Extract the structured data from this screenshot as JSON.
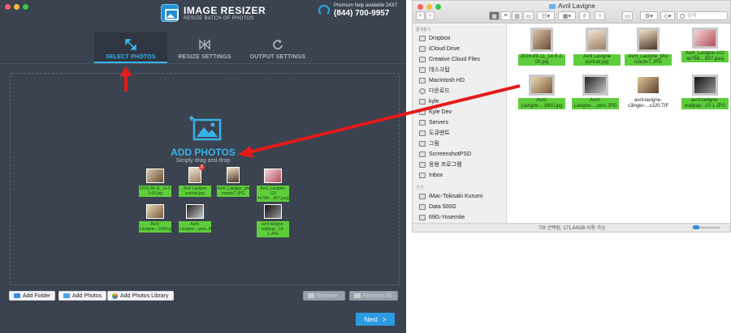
{
  "app": {
    "title": "IMAGE RESIZER",
    "subtitle": "RESIZE BATCH OF PHOTOS",
    "help_text": "Premium help available 24X7",
    "help_phone": "(844) 700-9957",
    "tabs": [
      {
        "label": "SELECT PHOTOS",
        "icon": "expand-arrows-icon",
        "active": true
      },
      {
        "label": "RESIZE SETTINGS",
        "icon": "resize-icon",
        "active": false
      },
      {
        "label": "OUTPUT SETTINGS",
        "icon": "refresh-icon",
        "active": false
      }
    ],
    "drop": {
      "title": "ADD PHOTOS",
      "subtitle": "Simply drag and drop"
    },
    "thumbs": [
      {
        "caption": "2016-09-11_14-5 2-00.jpg",
        "badge": ""
      },
      {
        "caption": "Avril Lavigne portrait.jpg",
        "badge": "2"
      },
      {
        "caption": "Avril_Lavigne_pho mactiv7.JPG",
        "badge": ""
      },
      {
        "caption": "Avril_Lavigne-102 4x768-...857.jpeg",
        "badge": ""
      },
      {
        "caption": "Avril-Lavigne-...1600.jpg",
        "badge": ""
      },
      {
        "caption": "Avril-Lavigne-...pers.JPG",
        "badge": ""
      },
      {
        "caption": "avril-lavigne-wallpap...10-1.JPG",
        "badge": ""
      }
    ],
    "buttons": {
      "add_folder": "Add Folder",
      "add_photos": "Add Photos",
      "add_library": "Add Photos Library",
      "remove": "Remove",
      "remove_all": "Remove All",
      "next": "Next",
      "next_arrow": ">"
    },
    "colors": {
      "accent": "#38b3ea",
      "background": "#3b4350",
      "next": "#2d9be0",
      "annotation": "#e31b1b",
      "selection": "#5fce3c"
    }
  },
  "finder": {
    "title": "Avril Lavigne",
    "search_placeholder": "검색",
    "sidebar": {
      "favorites_header": "즐겨찾기",
      "favorites": [
        "Dropbox",
        "iCloud Drive",
        "Creative Cloud Files",
        "데스크탑",
        "Macintosh HD",
        "다운로드",
        "kyle",
        "Kyle Dev",
        "Servers",
        "도큐멘트",
        "그림",
        "ScrreenshotPSD",
        "응용 프로그램",
        "Inbox"
      ],
      "devices_header": "기기",
      "devices": [
        "iMac-Tokisaki Kurumi",
        "Data 500G",
        "69G-Yosemite"
      ]
    },
    "files": [
      {
        "name": "2016-09-11_14-5 2-00.jpg",
        "selected": true
      },
      {
        "name": "Avril Lavigne portrait.jpg",
        "selected": true
      },
      {
        "name": "Avril_Lavigne_pho mactiv7.JPG",
        "selected": true
      },
      {
        "name": "Avril_Lavigne-102 4x768-...857.jpeg",
        "selected": true
      },
      {
        "name": "Avril-Lavigne-...1600.jpg",
        "selected": true
      },
      {
        "name": "Avril-Lavigne-...pers.JPG",
        "selected": true
      },
      {
        "name": "avril-lavigne-s3inger-...s120.TIF",
        "selected": false
      },
      {
        "name": "avril-lavigne-wallpap...10-1.JPG",
        "selected": true
      }
    ],
    "status": "7/8 선택됨, 171.64GB 사용 가능"
  }
}
